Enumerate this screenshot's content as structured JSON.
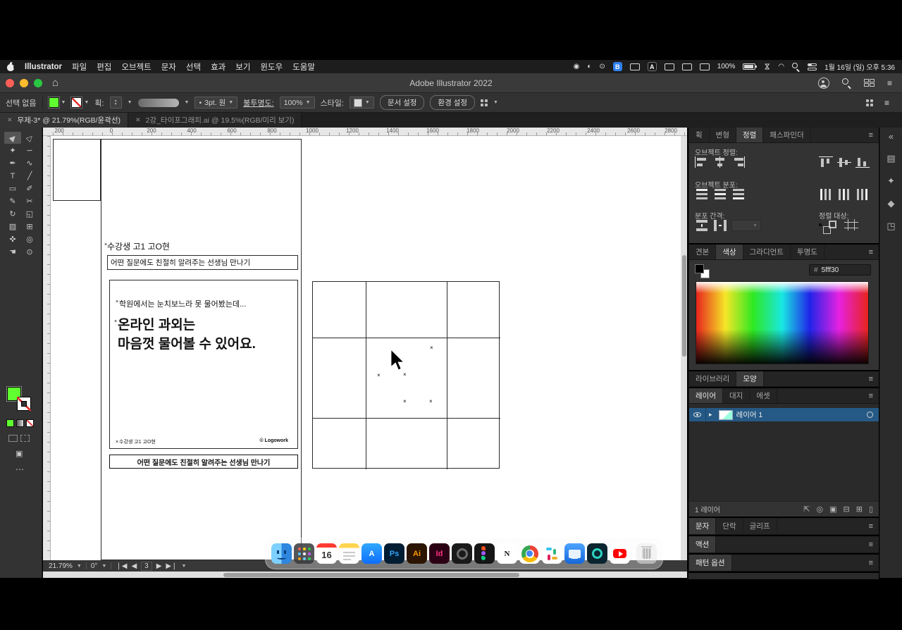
{
  "menubar": {
    "app_name": "Illustrator",
    "menus": [
      "파일",
      "편집",
      "오브젝트",
      "문자",
      "선택",
      "효과",
      "보기",
      "윈도우",
      "도움말"
    ],
    "badge_b": "B",
    "badge_a": "A",
    "battery_percent": "100%",
    "clock": "1월 16일 (일) 오후 5:36"
  },
  "titlebar": {
    "title": "Adobe Illustrator 2022"
  },
  "controlbar": {
    "selection_status": "선택 없음",
    "stroke_label": "획:",
    "profile_bullet": "•",
    "profile_value": "3pt. 원",
    "opacity_label": "불투명도:",
    "opacity_value": "100%",
    "style_label": "스타일:",
    "doc_setup_button": "문서 설정",
    "preferences_button": "환경 설정"
  },
  "doc_tabs": [
    {
      "close": "✕",
      "label": "무제-3* @ 21.79%(RGB/윤곽선)"
    },
    {
      "close": "✕",
      "label": "2강_타이포그래피.ai @ 19.5%(RGB/미리 보기)"
    }
  ],
  "ruler_marks": [
    "200",
    "0",
    "200",
    "400",
    "600",
    "800",
    "1000",
    "1200",
    "1400",
    "1600",
    "1800",
    "2000",
    "2200",
    "2400",
    "2600",
    "2800"
  ],
  "tool_icons": {
    "selection": "▶",
    "direct": "▷",
    "magic_wand": "✦",
    "lasso": "∽",
    "pen": "✒",
    "curvature": "∿",
    "text": "T",
    "line": "╱",
    "rectangle": "▭",
    "brush": "✐",
    "pencil": "✎",
    "scissors": "✂",
    "rotate": "↻",
    "scale": "◱",
    "gradient": "▨",
    "mesh": "⊞",
    "eyedropper": "✜",
    "blend": "◎",
    "hand": "☚",
    "zoom": "⊙"
  },
  "artwork": {
    "student_line": "수강생 고1 고O현",
    "banner": "어떤 질문에도 친절히 알려주는 선생님 만나기",
    "card_line1": "학원에서는 눈치보느라 못 물어봤는데...",
    "card_line2": "온라인 과외는",
    "card_line3": "마음껏 물어볼 수 있어요.",
    "card_footer_left": "수강생 고1 고O현",
    "card_footer_right": "© Logowork",
    "bottom_banner": "어떤 질문에도 친절히 알려주는 선생님 만나기"
  },
  "statusbar": {
    "zoom": "21.79%",
    "rotation": "0°",
    "artboard_number": "3"
  },
  "panels": {
    "align": {
      "tab_stroke": "획",
      "tab_transform": "변형",
      "tab_align": "정렬",
      "tab_pathfinder": "패스파인더",
      "align_objects": "오브젝트 정렬:",
      "distribute_objects": "오브젝트 분포:",
      "distribute_spacing": "분포 간격:",
      "align_to": "정렬 대상:"
    },
    "color": {
      "tab_swatches": "견본",
      "tab_color": "색상",
      "tab_gradient": "그라디언트",
      "tab_transparency": "투명도",
      "hex_label": "#",
      "hex_value": "5fff30"
    },
    "libs": {
      "tab_libraries": "라이브러리",
      "tab_appearance": "모양"
    },
    "layers": {
      "tab_layers": "레이어",
      "tab_artboards": "대지",
      "tab_assets": "에셋",
      "layer1_name": "레이어 1",
      "count": "1 레이어"
    },
    "type": {
      "tab_character": "문자",
      "tab_paragraph": "단락",
      "tab_glyphs": "글리프"
    },
    "actions": {
      "tab_actions": "액션"
    },
    "pattern": {
      "tab_pattern": "패턴 옵션"
    }
  },
  "dock": {
    "calendar_day": "16",
    "appstore_letter": "A",
    "ps": "Ps",
    "ai": "Ai",
    "id": "Id",
    "notion_letter": "N"
  },
  "colors": {
    "fill_green": "#5fff30",
    "hex_selected": "#5fff30"
  }
}
